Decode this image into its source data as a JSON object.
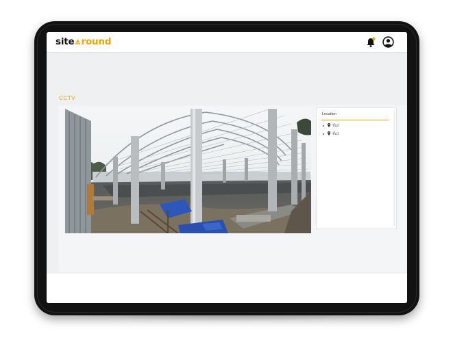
{
  "app": {
    "logo_part1": "site",
    "logo_part2": "round",
    "brand_color": "#f0a500"
  },
  "header": {
    "icons": [
      "notification-bell-icon",
      "user-account-icon"
    ]
  },
  "page": {
    "title": "CCTV"
  },
  "camera_feed": {
    "description_icon": "cctv-video-feed"
  },
  "location_panel": {
    "title": "Location",
    "items": [
      {
        "label": "ชั้น2"
      },
      {
        "label": "ชั้น1"
      }
    ]
  }
}
